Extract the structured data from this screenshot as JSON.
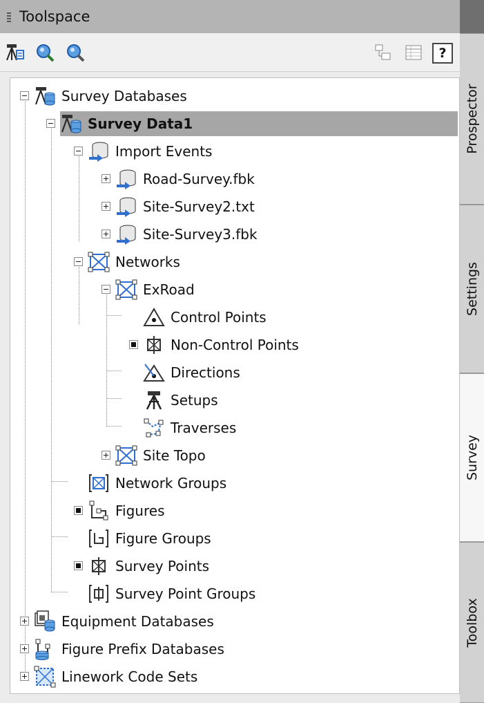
{
  "window": {
    "title": "Toolspace"
  },
  "toolbar": {
    "left_icons": [
      "survey-tripod-icon",
      "magnifier-icon",
      "magnifier-settings-icon"
    ],
    "right_icons": [
      "tree-view-icon",
      "list-view-icon",
      "help-icon"
    ],
    "help_label": "?"
  },
  "tree": {
    "survey_databases": "Survey Databases",
    "survey_data1": "Survey Data1",
    "import_events": "Import Events",
    "road_survey": "Road-Survey.fbk",
    "site_survey2": "Site-Survey2.txt",
    "site_survey3": "Site-Survey3.fbk",
    "networks": "Networks",
    "exroad": "ExRoad",
    "control_points": "Control Points",
    "non_control_points": "Non-Control Points",
    "directions": "Directions",
    "setups": "Setups",
    "traverses": "Traverses",
    "site_topo": "Site Topo",
    "network_groups": "Network Groups",
    "figures": "Figures",
    "figure_groups": "Figure Groups",
    "survey_points": "Survey Points",
    "survey_point_groups": "Survey Point Groups",
    "equipment_databases": "Equipment Databases",
    "figure_prefix_databases": "Figure Prefix Databases",
    "linework_code_sets": "Linework Code Sets"
  },
  "tabs": {
    "prospector": "Prospector",
    "settings": "Settings",
    "survey": "Survey",
    "toolbox": "Toolbox",
    "active": "Survey"
  },
  "colors": {
    "selection": "#a6a6a6",
    "titlebar": "#b4b4b4",
    "accent_blue": "#2f6fd0"
  }
}
